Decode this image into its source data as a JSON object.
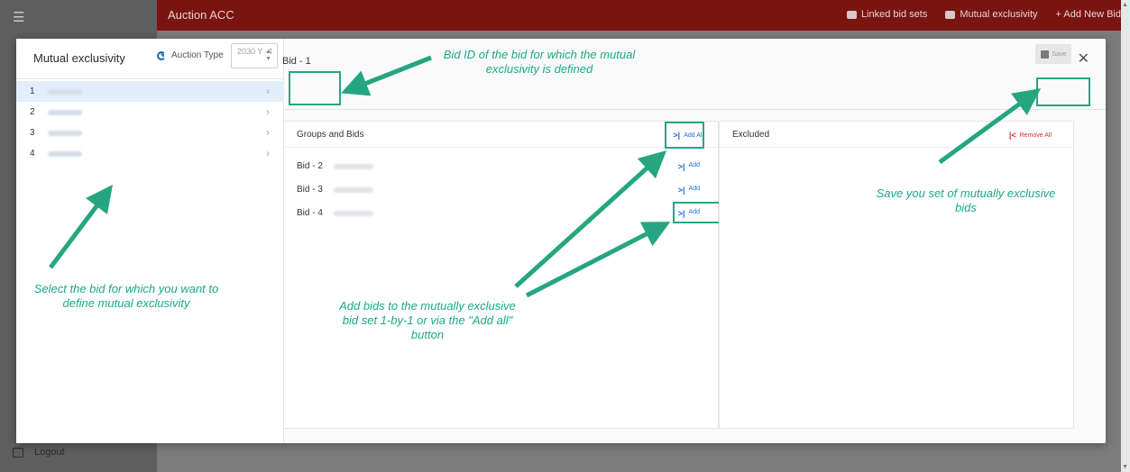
{
  "app": {
    "title": "Auction ACC",
    "actions": [
      {
        "label": "Linked bid sets",
        "icon": "link-icon"
      },
      {
        "label": "Mutual exclusivity",
        "icon": "exclusion-icon"
      },
      {
        "label": "+ Add New Bid",
        "icon": "plus-icon"
      }
    ],
    "logout_label": "Logout"
  },
  "modal": {
    "title": "Mutual exclusivity",
    "auction_type_label": "Auction Type",
    "auction_type_value": "2030 Y -4",
    "bids": [
      {
        "index": "1",
        "active": true
      },
      {
        "index": "2",
        "active": false
      },
      {
        "index": "3",
        "active": false
      },
      {
        "index": "4",
        "active": false
      }
    ],
    "selected_bid": "Bid - 1",
    "save_label": "Save",
    "groups_title": "Groups and Bids",
    "add_all_label": "Add All",
    "excluded_title": "Excluded",
    "remove_all_label": "Remove All",
    "rows": [
      {
        "name": "Bid - 2",
        "add": "Add"
      },
      {
        "name": "Bid - 3",
        "add": "Add"
      },
      {
        "name": "Bid - 4",
        "add": "Add"
      }
    ]
  },
  "annotations": {
    "bid_id_note": "Bid ID of the bid for which the mutual exclusivity is defined",
    "select_note": "Select the bid for which you want to define mutual exclusivity",
    "add_note": "Add bids to the mutually exclusive bid set 1-by-1 or via the \"Add all\" button",
    "save_note": "Save you set of mutually exclusive bids"
  },
  "colors": {
    "topbar": "#7a1410",
    "annotation": "#1aa985",
    "link_blue": "#1e6fd9",
    "remove_red": "#d32f2f"
  }
}
